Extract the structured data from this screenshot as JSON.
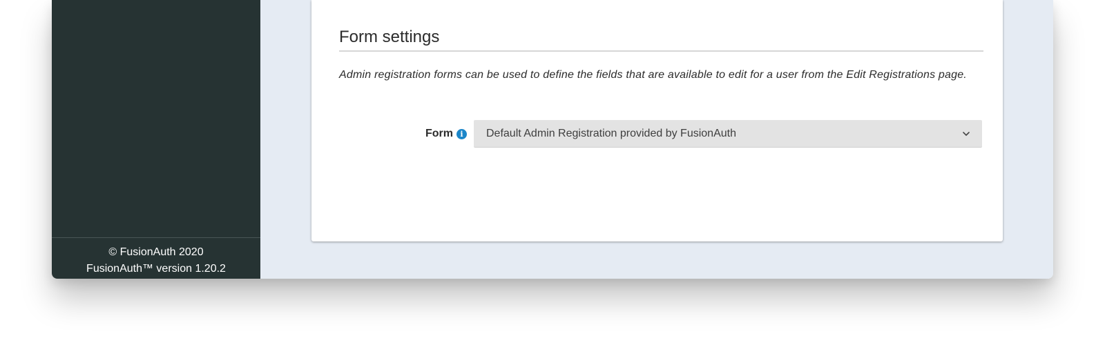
{
  "sidebar": {
    "footer": {
      "copyright": "© FusionAuth 2020",
      "version": "FusionAuth™ version 1.20.2"
    }
  },
  "form_settings": {
    "title": "Form settings",
    "description": "Admin registration forms can be used to define the fields that are available to edit for a user from the Edit Registrations page.",
    "form_field": {
      "label": "Form",
      "info_icon": "info-icon",
      "selected_value": "Default Admin Registration provided by FusionAuth",
      "dropdown_icon": "chevron-down-icon"
    }
  },
  "colors": {
    "sidebar_bg": "#263333",
    "content_bg": "#e5ebf3",
    "info_blue": "#1b86c9",
    "select_bg": "#e3e3e3"
  }
}
